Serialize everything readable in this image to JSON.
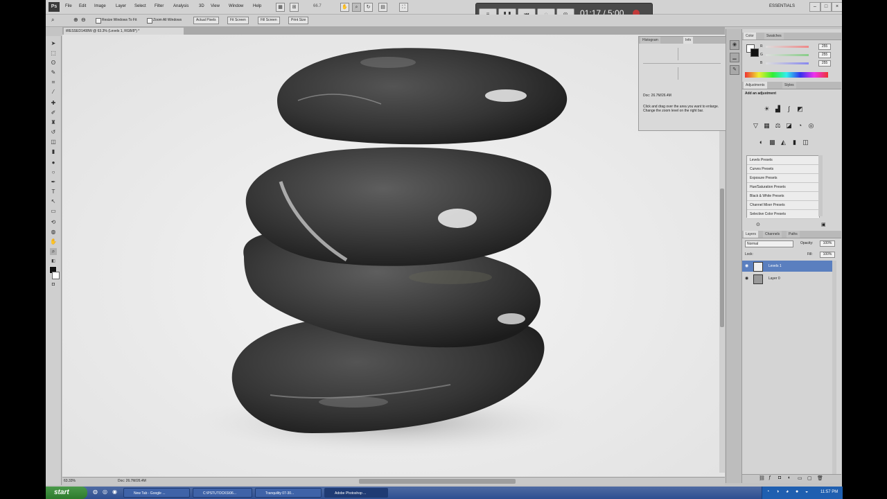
{
  "menubar": {
    "items": [
      "File",
      "Edit",
      "Image",
      "Layer",
      "Select",
      "Filter",
      "Analysis",
      "3D",
      "View",
      "Window",
      "Help"
    ],
    "zoom_value": "66.7",
    "workspace": "ESSENTIALS"
  },
  "recorder": {
    "time": "01:17 / 5:00"
  },
  "options_bar": {
    "resize_windows_label": "Resize Windows To Fit",
    "zoom_all_label": "Zoom All Windows",
    "actual_pixels": "Actual Pixels",
    "fit_screen": "Fit Screen",
    "fill_screen": "Fill Screen",
    "print_size": "Print Size"
  },
  "document": {
    "tab_title": "tRESSED1408W @ 63.3% (Levels 1, RGB/8*) *",
    "status_zoom": "63.33%",
    "status_doc": "Doc: 26.7M/26.4M"
  },
  "info_panel": {
    "tabs": [
      "Histogram",
      "Info"
    ],
    "doc": "Doc: 26.7M/26.4M",
    "hint": "Click and drag over the area you want to enlarge. Change the zoom level on the right bar."
  },
  "color_panel": {
    "tabs": [
      "Color",
      "Swatches"
    ],
    "channels": [
      "R",
      "G",
      "B"
    ],
    "values": [
      "255",
      "255",
      "255"
    ]
  },
  "adjustments_panel": {
    "tabs": [
      "Adjustments",
      "Styles"
    ],
    "heading": "Add an adjustment",
    "presets": [
      "Levels Presets",
      "Curves Presets",
      "Exposure Presets",
      "Hue/Saturation Presets",
      "Black & White Presets",
      "Channel Mixer Presets",
      "Selective Color Presets"
    ]
  },
  "layers_panel": {
    "tabs": [
      "Layers",
      "Channels",
      "Paths"
    ],
    "blend_mode": "Normal",
    "opacity_label": "Opacity:",
    "opacity": "100%",
    "fill_label": "Fill:",
    "fill": "100%",
    "lock_label": "Lock:",
    "layers": [
      "Levels 1",
      "Layer 0"
    ]
  },
  "taskbar": {
    "start": "start",
    "tasks": [
      "New Tab - Google ...",
      "C:\\PSTUTOCKS\\06...",
      "Tranquility 07-30...",
      "Adobe Photoshop ..."
    ],
    "clock": "11:57 PM"
  }
}
